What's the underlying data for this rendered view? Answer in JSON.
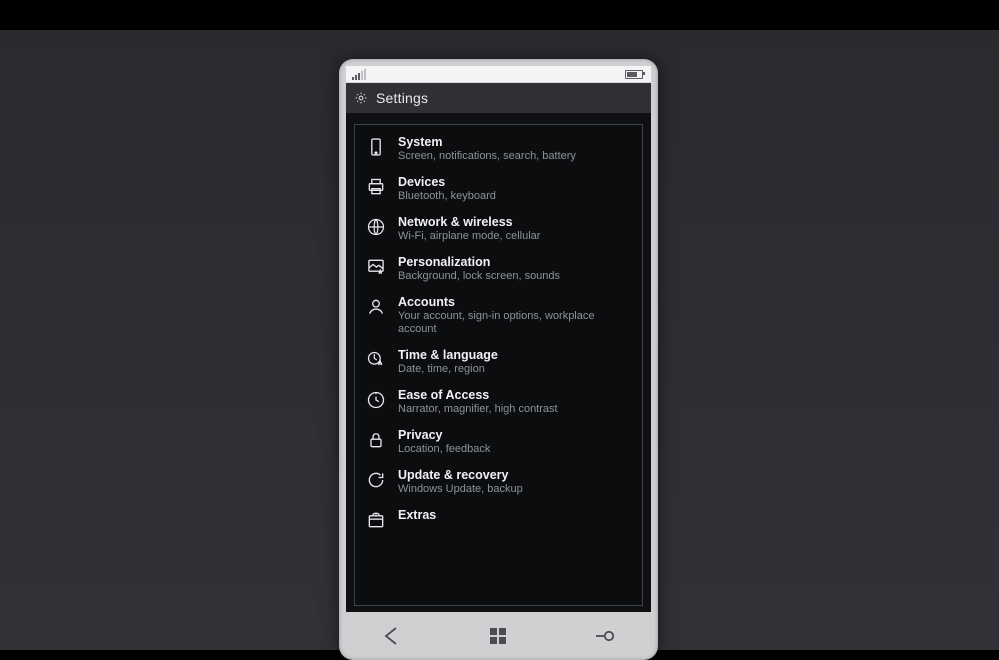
{
  "header": {
    "title": "Settings"
  },
  "items": [
    {
      "icon": "phone-portrait-icon",
      "title": "System",
      "desc": "Screen, notifications, search, battery"
    },
    {
      "icon": "printer-icon",
      "title": "Devices",
      "desc": "Bluetooth, keyboard"
    },
    {
      "icon": "globe-icon",
      "title": "Network & wireless",
      "desc": "Wi-Fi, airplane mode, cellular"
    },
    {
      "icon": "personalization-icon",
      "title": "Personalization",
      "desc": "Background, lock screen, sounds"
    },
    {
      "icon": "person-icon",
      "title": "Accounts",
      "desc": "Your account, sign-in options, workplace account"
    },
    {
      "icon": "time-language-icon",
      "title": "Time & language",
      "desc": "Date, time, region"
    },
    {
      "icon": "ease-of-access-icon",
      "title": "Ease of Access",
      "desc": "Narrator, magnifier, high contrast"
    },
    {
      "icon": "lock-icon",
      "title": "Privacy",
      "desc": "Location, feedback"
    },
    {
      "icon": "update-icon",
      "title": "Update & recovery",
      "desc": "Windows Update, backup"
    },
    {
      "icon": "extras-icon",
      "title": "Extras",
      "desc": ""
    }
  ],
  "accent_color": "#e6e8eb"
}
